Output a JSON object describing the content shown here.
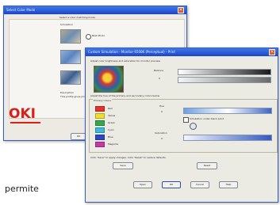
{
  "caption": "permite",
  "window1": {
    "title": "Select Color Mode",
    "heading": "Select a color matching mode",
    "section_label": "Simulation",
    "radio_labels": [
      "Best Photo",
      "Vivid",
      "Graphics"
    ],
    "description_heading": "Description",
    "description_text": "This profile gives priority to photo reproduction",
    "logo": "OKI",
    "ok_label": "OK"
  },
  "window2": {
    "title": "Custom Simulation - Monitor 6500K (Perceptual) - Print",
    "intro": "Adjust color brightness and saturation for monitor preview",
    "balance_label": "Balance",
    "balance_value": "0",
    "adjust_intro": "Adjust the hue of the primary and secondary colors below",
    "primary_colors_label": "Primary Colors",
    "colors": [
      {
        "name": "Red",
        "value": "0",
        "color": "#e4322a"
      },
      {
        "name": "Yellow",
        "value": "",
        "color": "#f0dd2c"
      },
      {
        "name": "Green",
        "value": "",
        "color": "#37a64d"
      },
      {
        "name": "Cyan",
        "value": "",
        "color": "#3bbbd9"
      },
      {
        "name": "Blue",
        "value": "",
        "color": "#2c47c6"
      },
      {
        "name": "Magenta",
        "value": "",
        "color": "#c33aa5"
      }
    ],
    "hue_label": "Hue",
    "saturation_label": "Saturation",
    "checkbox_label": "Simulation under black point",
    "footer_note": "Click \"Save\" to apply changes. Click \"Reset\" to restore defaults.",
    "save_label": "Save",
    "reset_label": "Reset",
    "buttons": [
      "Open",
      "OK",
      "Cancel",
      "Help"
    ]
  }
}
